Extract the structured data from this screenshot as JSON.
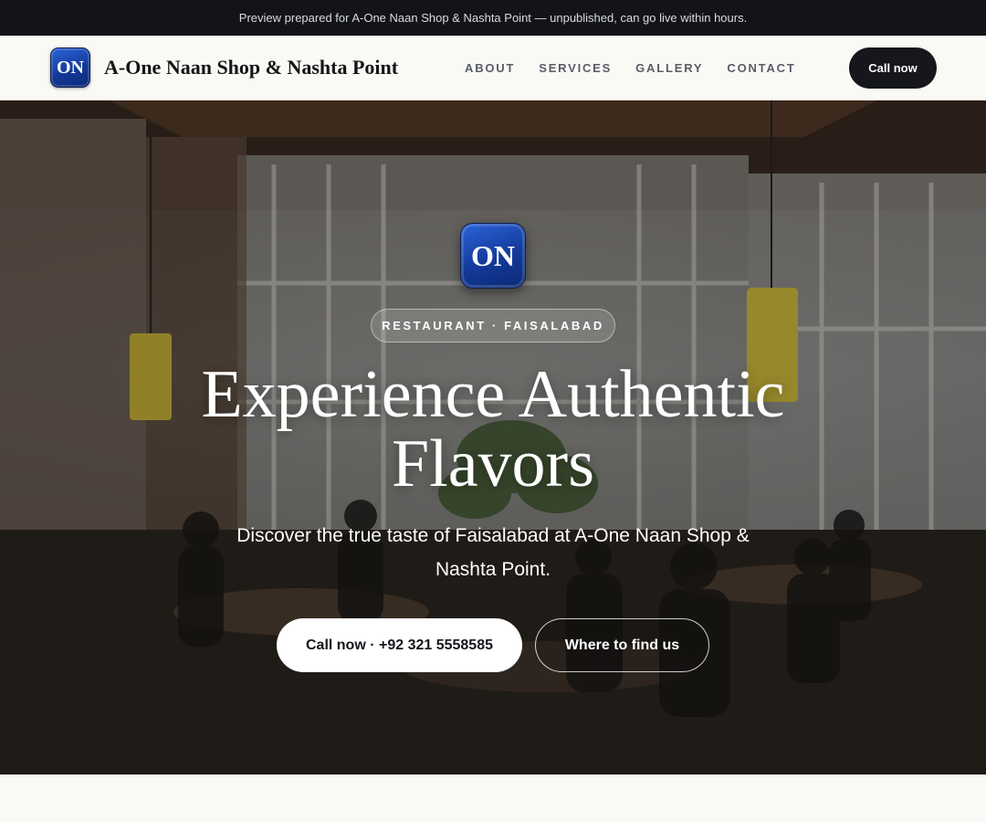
{
  "preview_bar": {
    "text": "Preview prepared for A-One Naan Shop & Nashta Point — unpublished, can go live within hours."
  },
  "header": {
    "logo_text": "ON",
    "brand": "A-One Naan Shop & Nashta Point",
    "nav": [
      {
        "label": "ABOUT"
      },
      {
        "label": "SERVICES"
      },
      {
        "label": "GALLERY"
      },
      {
        "label": "CONTACT"
      }
    ],
    "cta_label": "Call now"
  },
  "hero": {
    "logo_text": "ON",
    "pill": "RESTAURANT · FAISALABAD",
    "title": "Experience Authentic Flavors",
    "subtitle": "Discover the true taste of Faisalabad at A-One Naan Shop & Nashta Point.",
    "primary_button": "Call now · +92 321 5558585",
    "secondary_button": "Where to find us"
  },
  "colors": {
    "preview_bar_bg": "#121418",
    "cta_dark": "#15171c",
    "logo_blue": "#143a9a"
  }
}
